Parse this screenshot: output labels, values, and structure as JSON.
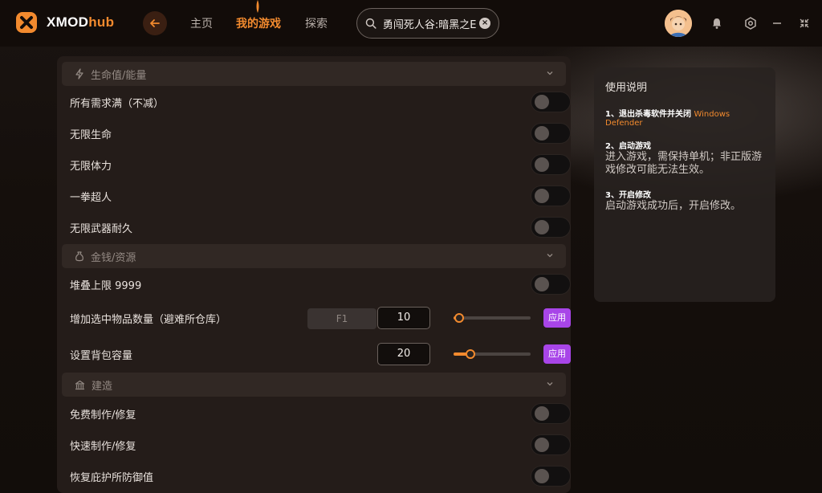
{
  "app": {
    "brand_main": "XMOD",
    "brand_sub": "hub"
  },
  "nav": {
    "home": "主页",
    "my_games": "我的游戏",
    "explore": "探索"
  },
  "search": {
    "value": "勇闯死人谷:暗黑之E"
  },
  "sections": [
    {
      "title": "生命值/能量",
      "icon": "lightning-icon",
      "rows": [
        {
          "label": "所有需求满（不减）",
          "enabled": false
        },
        {
          "label": "无限生命",
          "enabled": false
        },
        {
          "label": "无限体力",
          "enabled": false
        },
        {
          "label": "一拳超人",
          "enabled": false
        },
        {
          "label": "无限武器耐久",
          "enabled": false
        }
      ]
    },
    {
      "title": "金钱/资源",
      "icon": "money-bag-icon",
      "rows": [
        {
          "label": "堆叠上限 9999",
          "enabled": false
        },
        {
          "label": "增加选中物品数量（避难所仓库）",
          "hotkey": "F1",
          "value": "10",
          "slider_fraction": 0.05,
          "apply": "应用"
        },
        {
          "label": "设置背包容量",
          "value": "20",
          "slider_fraction": 0.2,
          "apply": "应用"
        }
      ]
    },
    {
      "title": "建造",
      "icon": "building-icon",
      "rows": [
        {
          "label": "免费制作/修复",
          "enabled": false
        },
        {
          "label": "快速制作/修复",
          "enabled": false
        },
        {
          "label": "恢复庇护所防御值",
          "enabled": false
        }
      ]
    }
  ],
  "instructions": {
    "title": "使用说明",
    "step1_head": "1、退出杀毒软件并关闭",
    "step1_highlight": "Windows Defender",
    "step2_head": "2、启动游戏",
    "step2_body": "进入游戏，需保持单机；非正版游戏修改可能无法生效。",
    "step3_head": "3、开启修改",
    "step3_body": "启动游戏成功后，开启修改。"
  },
  "colors": {
    "accent": "#f28a2e",
    "apply_button": "#a845e8",
    "panel": "#241c19"
  }
}
